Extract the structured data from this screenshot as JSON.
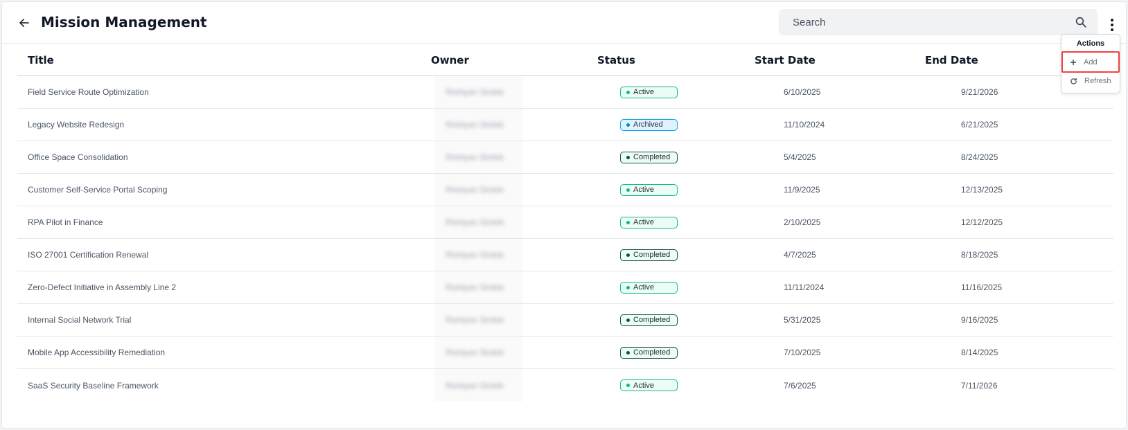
{
  "header": {
    "title": "Mission Management",
    "search_placeholder": "Search"
  },
  "icons": {
    "back": "arrow-left-icon",
    "search": "search-icon",
    "more": "more-vertical-icon",
    "add": "plus-icon",
    "refresh": "refresh-icon"
  },
  "actions_menu": {
    "title": "Actions",
    "add_label": "Add",
    "refresh_label": "Refresh"
  },
  "table": {
    "columns": [
      "Title",
      "Owner",
      "Status",
      "Start Date",
      "End Date"
    ],
    "rows": [
      {
        "title": "Field Service Route Optimization",
        "owner": "Rishiyan Sirdeb",
        "status": "Active",
        "status_kind": "active",
        "start": "6/10/2025",
        "end": "9/21/2026"
      },
      {
        "title": "Legacy Website Redesign",
        "owner": "Rishiyan Sirdeb",
        "status": "Archived",
        "status_kind": "archived",
        "start": "11/10/2024",
        "end": "6/21/2025"
      },
      {
        "title": "Office Space Consolidation",
        "owner": "Rishiyan Sirdeb",
        "status": "Completed",
        "status_kind": "completed",
        "start": "5/4/2025",
        "end": "8/24/2025"
      },
      {
        "title": "Customer Self-Service Portal Scoping",
        "owner": "Rishiyan Sirdeb",
        "status": "Active",
        "status_kind": "active",
        "start": "11/9/2025",
        "end": "12/13/2025"
      },
      {
        "title": "RPA Pilot in Finance",
        "owner": "Rishiyan Sirdeb",
        "status": "Active",
        "status_kind": "active",
        "start": "2/10/2025",
        "end": "12/12/2025"
      },
      {
        "title": "ISO 27001 Certification Renewal",
        "owner": "Rishiyan Sirdeb",
        "status": "Completed",
        "status_kind": "completed",
        "start": "4/7/2025",
        "end": "8/18/2025"
      },
      {
        "title": "Zero-Defect Initiative in Assembly Line 2",
        "owner": "Rishiyan Sirdeb",
        "status": "Active",
        "status_kind": "active",
        "start": "11/11/2024",
        "end": "11/16/2025"
      },
      {
        "title": "Internal Social Network Trial",
        "owner": "Rishiyan Sirdeb",
        "status": "Completed",
        "status_kind": "completed",
        "start": "5/31/2025",
        "end": "9/16/2025"
      },
      {
        "title": "Mobile App Accessibility Remediation",
        "owner": "Rishiyan Sirdeb",
        "status": "Completed",
        "status_kind": "completed",
        "start": "7/10/2025",
        "end": "8/14/2025"
      },
      {
        "title": "SaaS Security Baseline Framework",
        "owner": "Rishiyan Sirdeb",
        "status": "Active",
        "status_kind": "active",
        "start": "7/6/2025",
        "end": "7/11/2026"
      }
    ]
  },
  "colors": {
    "active_border": "#10b981",
    "archived_border": "#0ea5e9",
    "completed_border": "#134e4a",
    "highlight": "#ef4444"
  }
}
